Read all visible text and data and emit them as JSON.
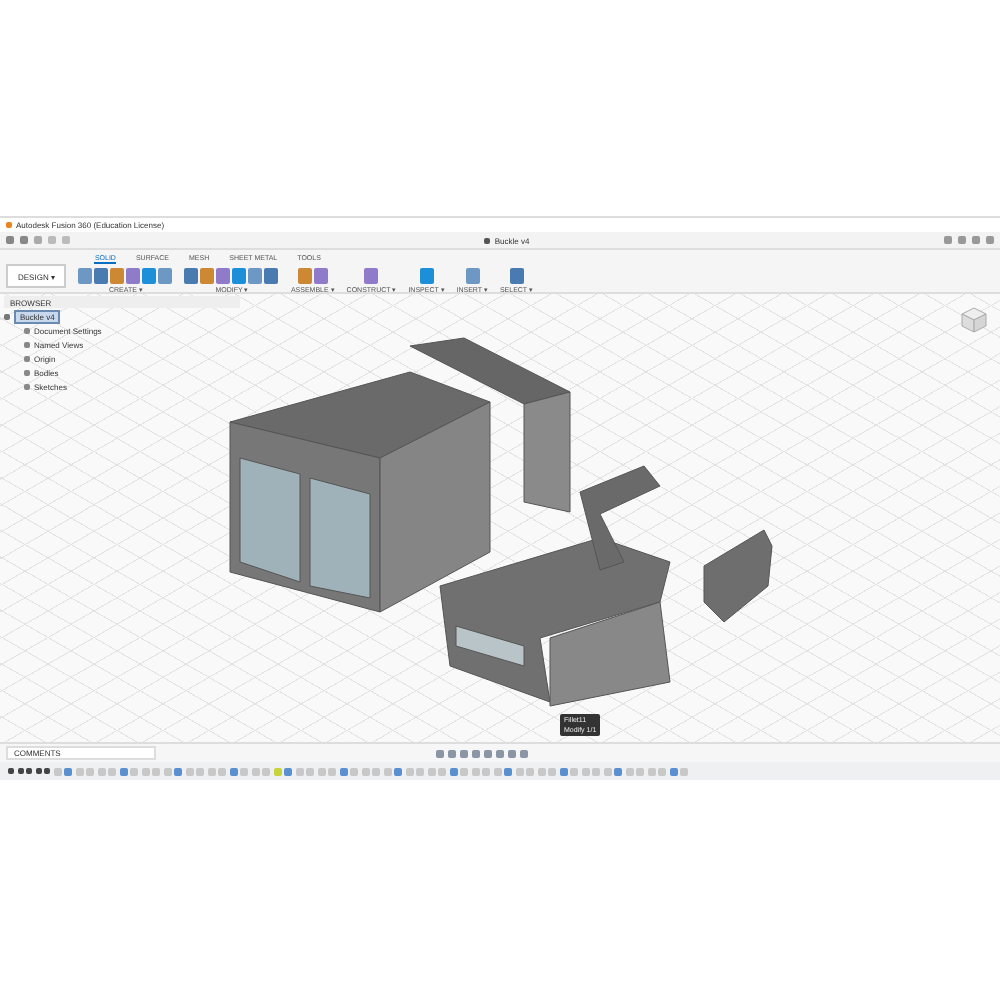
{
  "window": {
    "title": "Autodesk Fusion 360 (Education License)"
  },
  "document_tab": {
    "title": "Buckle v4"
  },
  "workspace": {
    "label": "DESIGN ▾"
  },
  "ribbon_tabs": [
    {
      "label": "SOLID",
      "selected": true
    },
    {
      "label": "SURFACE",
      "selected": false
    },
    {
      "label": "MESH",
      "selected": false
    },
    {
      "label": "SHEET METAL",
      "selected": false
    },
    {
      "label": "TOOLS",
      "selected": false
    }
  ],
  "tool_groups": [
    {
      "label": "CREATE ▾"
    },
    {
      "label": "MODIFY ▾"
    },
    {
      "label": "ASSEMBLE ▾"
    },
    {
      "label": "CONSTRUCT ▾"
    },
    {
      "label": "INSPECT ▾"
    },
    {
      "label": "INSERT ▾"
    },
    {
      "label": "SELECT ▾"
    }
  ],
  "browser": {
    "title": "BROWSER",
    "items": [
      {
        "label": "Buckle v4",
        "selected": true,
        "children": [
          {
            "label": "Document Settings"
          },
          {
            "label": "Named Views"
          },
          {
            "label": "Origin"
          },
          {
            "label": "Bodies"
          },
          {
            "label": "Sketches"
          }
        ]
      }
    ]
  },
  "comments": {
    "label": "COMMENTS"
  },
  "tooltip": {
    "lines": [
      "Fillet11",
      "Modify 1/1"
    ]
  }
}
